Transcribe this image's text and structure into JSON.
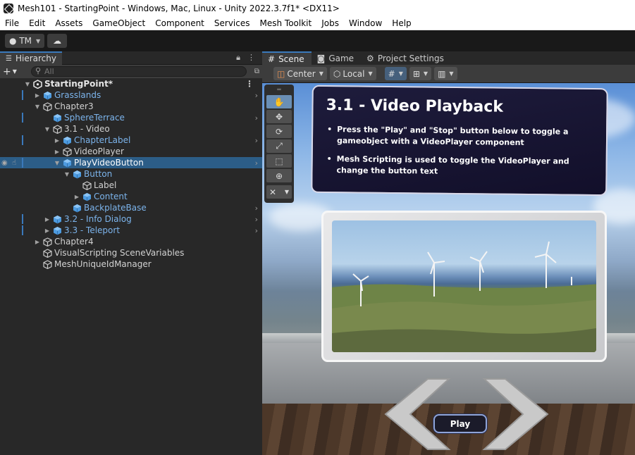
{
  "window": {
    "title": "Mesh101 - StartingPoint - Windows, Mac, Linux - Unity 2022.3.7f1* <DX11>"
  },
  "menu": [
    "File",
    "Edit",
    "Assets",
    "GameObject",
    "Component",
    "Services",
    "Mesh Toolkit",
    "Jobs",
    "Window",
    "Help"
  ],
  "toolbar": {
    "account_label": "TM",
    "account_icon": "user-icon",
    "cloud_icon": "cloud-icon"
  },
  "hierarchy": {
    "tab_label": "Hierarchy",
    "search_placeholder": "All",
    "items": [
      {
        "label": "StartingPoint*",
        "depth": 0,
        "expanded": true,
        "style": "root"
      },
      {
        "label": "Grasslands",
        "depth": 1,
        "expanded": false,
        "style": "prefab"
      },
      {
        "label": "Chapter3",
        "depth": 1,
        "expanded": true,
        "style": "normal"
      },
      {
        "label": "SphereTerrace",
        "depth": 2,
        "expanded": null,
        "style": "prefab"
      },
      {
        "label": "3.1 - Video",
        "depth": 2,
        "expanded": true,
        "style": "normal"
      },
      {
        "label": "ChapterLabel",
        "depth": 3,
        "expanded": false,
        "style": "prefab"
      },
      {
        "label": "VideoPlayer",
        "depth": 3,
        "expanded": false,
        "style": "normal"
      },
      {
        "label": "PlayVideoButton",
        "depth": 3,
        "expanded": true,
        "style": "prefab",
        "selected": true
      },
      {
        "label": "Button",
        "depth": 4,
        "expanded": true,
        "style": "prefab"
      },
      {
        "label": "Label",
        "depth": 5,
        "expanded": null,
        "style": "normal"
      },
      {
        "label": "Content",
        "depth": 5,
        "expanded": false,
        "style": "prefab"
      },
      {
        "label": "BackplateBase",
        "depth": 4,
        "expanded": null,
        "style": "prefab"
      },
      {
        "label": "3.2 - Info Dialog",
        "depth": 2,
        "expanded": false,
        "style": "prefab"
      },
      {
        "label": "3.3 - Teleport",
        "depth": 2,
        "expanded": false,
        "style": "prefab"
      },
      {
        "label": "Chapter4",
        "depth": 1,
        "expanded": false,
        "style": "normal"
      },
      {
        "label": "VisualScripting SceneVariables",
        "depth": 1,
        "expanded": null,
        "style": "normal"
      },
      {
        "label": "MeshUniqueIdManager",
        "depth": 1,
        "expanded": null,
        "style": "normal"
      }
    ]
  },
  "scene_tabs": [
    {
      "label": "Scene",
      "icon": "grid-icon",
      "active": true
    },
    {
      "label": "Game",
      "icon": "gamepad-icon",
      "active": false
    },
    {
      "label": "Project Settings",
      "icon": "gear-icon",
      "active": false
    }
  ],
  "scene_toolbar": {
    "pivot_label": "Center",
    "space_label": "Local"
  },
  "scene": {
    "info_title": "3.1 - Video Playback",
    "info_bullets": [
      "Press the \"Play\" and \"Stop\" button below to toggle a gameobject with a VideoPlayer component",
      "Mesh Scripting is used to toggle the VideoPlayer and change the button text"
    ],
    "play_label": "Play"
  },
  "colors": {
    "accent": "#3a79bb",
    "prefab_text": "#7cb4ec",
    "selection": "#2c5d87"
  }
}
